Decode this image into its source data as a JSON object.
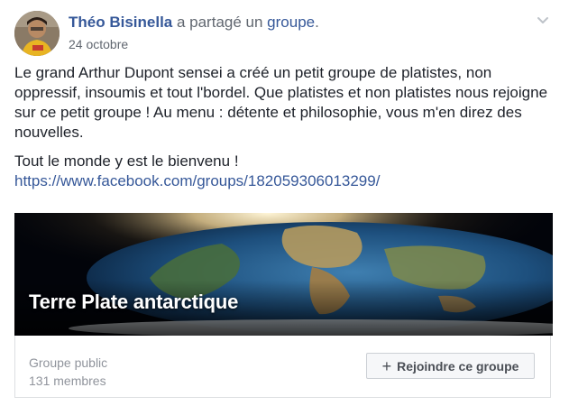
{
  "post": {
    "author": "Théo Bisinella",
    "action_text": " a partagé un ",
    "object_text": "groupe",
    "trailing": ".",
    "date": "24 octobre",
    "body_paragraphs": [
      "Le grand Arthur Dupont sensei a créé un petit groupe de platistes, non oppressif, insoumis et tout l'bordel. Que platistes et non platistes nous rejoigne sur ce petit groupe ! Au menu : détente et philosophie, vous m'en direz des nouvelles.",
      "Tout le monde y est le bienvenu !"
    ],
    "link": "https://www.facebook.com/groups/182059306013299/"
  },
  "group_card": {
    "name": "Terre Plate antarctique",
    "privacy": "Groupe public",
    "members": "131 membres",
    "join_label": "Rejoindre ce groupe",
    "join_icon": "+"
  },
  "icons": {
    "options": "chevron-down-icon",
    "join": "plus-icon"
  },
  "colors": {
    "link": "#365899",
    "text": "#1d2129",
    "muted": "#616770",
    "border": "#dddfe2"
  }
}
